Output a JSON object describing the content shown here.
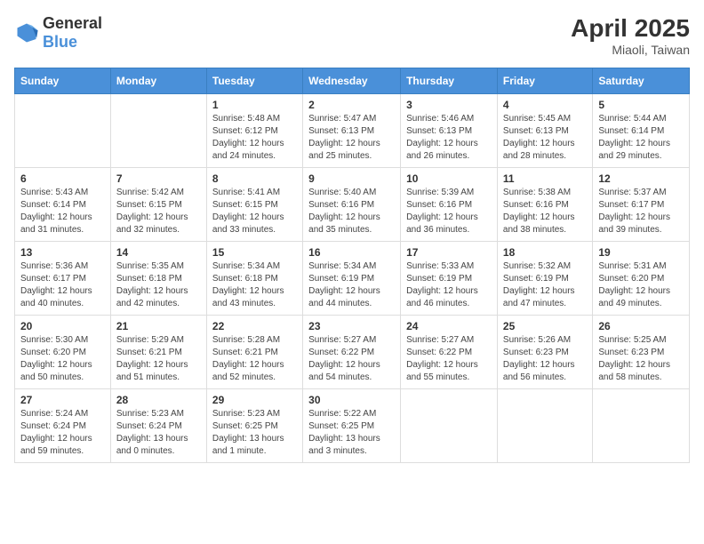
{
  "logo": {
    "general": "General",
    "blue": "Blue"
  },
  "title": "April 2025",
  "location": "Miaoli, Taiwan",
  "days_of_week": [
    "Sunday",
    "Monday",
    "Tuesday",
    "Wednesday",
    "Thursday",
    "Friday",
    "Saturday"
  ],
  "weeks": [
    [
      {
        "day": "",
        "info": ""
      },
      {
        "day": "",
        "info": ""
      },
      {
        "day": "1",
        "info": "Sunrise: 5:48 AM\nSunset: 6:12 PM\nDaylight: 12 hours and 24 minutes."
      },
      {
        "day": "2",
        "info": "Sunrise: 5:47 AM\nSunset: 6:13 PM\nDaylight: 12 hours and 25 minutes."
      },
      {
        "day": "3",
        "info": "Sunrise: 5:46 AM\nSunset: 6:13 PM\nDaylight: 12 hours and 26 minutes."
      },
      {
        "day": "4",
        "info": "Sunrise: 5:45 AM\nSunset: 6:13 PM\nDaylight: 12 hours and 28 minutes."
      },
      {
        "day": "5",
        "info": "Sunrise: 5:44 AM\nSunset: 6:14 PM\nDaylight: 12 hours and 29 minutes."
      }
    ],
    [
      {
        "day": "6",
        "info": "Sunrise: 5:43 AM\nSunset: 6:14 PM\nDaylight: 12 hours and 31 minutes."
      },
      {
        "day": "7",
        "info": "Sunrise: 5:42 AM\nSunset: 6:15 PM\nDaylight: 12 hours and 32 minutes."
      },
      {
        "day": "8",
        "info": "Sunrise: 5:41 AM\nSunset: 6:15 PM\nDaylight: 12 hours and 33 minutes."
      },
      {
        "day": "9",
        "info": "Sunrise: 5:40 AM\nSunset: 6:16 PM\nDaylight: 12 hours and 35 minutes."
      },
      {
        "day": "10",
        "info": "Sunrise: 5:39 AM\nSunset: 6:16 PM\nDaylight: 12 hours and 36 minutes."
      },
      {
        "day": "11",
        "info": "Sunrise: 5:38 AM\nSunset: 6:16 PM\nDaylight: 12 hours and 38 minutes."
      },
      {
        "day": "12",
        "info": "Sunrise: 5:37 AM\nSunset: 6:17 PM\nDaylight: 12 hours and 39 minutes."
      }
    ],
    [
      {
        "day": "13",
        "info": "Sunrise: 5:36 AM\nSunset: 6:17 PM\nDaylight: 12 hours and 40 minutes."
      },
      {
        "day": "14",
        "info": "Sunrise: 5:35 AM\nSunset: 6:18 PM\nDaylight: 12 hours and 42 minutes."
      },
      {
        "day": "15",
        "info": "Sunrise: 5:34 AM\nSunset: 6:18 PM\nDaylight: 12 hours and 43 minutes."
      },
      {
        "day": "16",
        "info": "Sunrise: 5:34 AM\nSunset: 6:19 PM\nDaylight: 12 hours and 44 minutes."
      },
      {
        "day": "17",
        "info": "Sunrise: 5:33 AM\nSunset: 6:19 PM\nDaylight: 12 hours and 46 minutes."
      },
      {
        "day": "18",
        "info": "Sunrise: 5:32 AM\nSunset: 6:19 PM\nDaylight: 12 hours and 47 minutes."
      },
      {
        "day": "19",
        "info": "Sunrise: 5:31 AM\nSunset: 6:20 PM\nDaylight: 12 hours and 49 minutes."
      }
    ],
    [
      {
        "day": "20",
        "info": "Sunrise: 5:30 AM\nSunset: 6:20 PM\nDaylight: 12 hours and 50 minutes."
      },
      {
        "day": "21",
        "info": "Sunrise: 5:29 AM\nSunset: 6:21 PM\nDaylight: 12 hours and 51 minutes."
      },
      {
        "day": "22",
        "info": "Sunrise: 5:28 AM\nSunset: 6:21 PM\nDaylight: 12 hours and 52 minutes."
      },
      {
        "day": "23",
        "info": "Sunrise: 5:27 AM\nSunset: 6:22 PM\nDaylight: 12 hours and 54 minutes."
      },
      {
        "day": "24",
        "info": "Sunrise: 5:27 AM\nSunset: 6:22 PM\nDaylight: 12 hours and 55 minutes."
      },
      {
        "day": "25",
        "info": "Sunrise: 5:26 AM\nSunset: 6:23 PM\nDaylight: 12 hours and 56 minutes."
      },
      {
        "day": "26",
        "info": "Sunrise: 5:25 AM\nSunset: 6:23 PM\nDaylight: 12 hours and 58 minutes."
      }
    ],
    [
      {
        "day": "27",
        "info": "Sunrise: 5:24 AM\nSunset: 6:24 PM\nDaylight: 12 hours and 59 minutes."
      },
      {
        "day": "28",
        "info": "Sunrise: 5:23 AM\nSunset: 6:24 PM\nDaylight: 13 hours and 0 minutes."
      },
      {
        "day": "29",
        "info": "Sunrise: 5:23 AM\nSunset: 6:25 PM\nDaylight: 13 hours and 1 minute."
      },
      {
        "day": "30",
        "info": "Sunrise: 5:22 AM\nSunset: 6:25 PM\nDaylight: 13 hours and 3 minutes."
      },
      {
        "day": "",
        "info": ""
      },
      {
        "day": "",
        "info": ""
      },
      {
        "day": "",
        "info": ""
      }
    ]
  ]
}
